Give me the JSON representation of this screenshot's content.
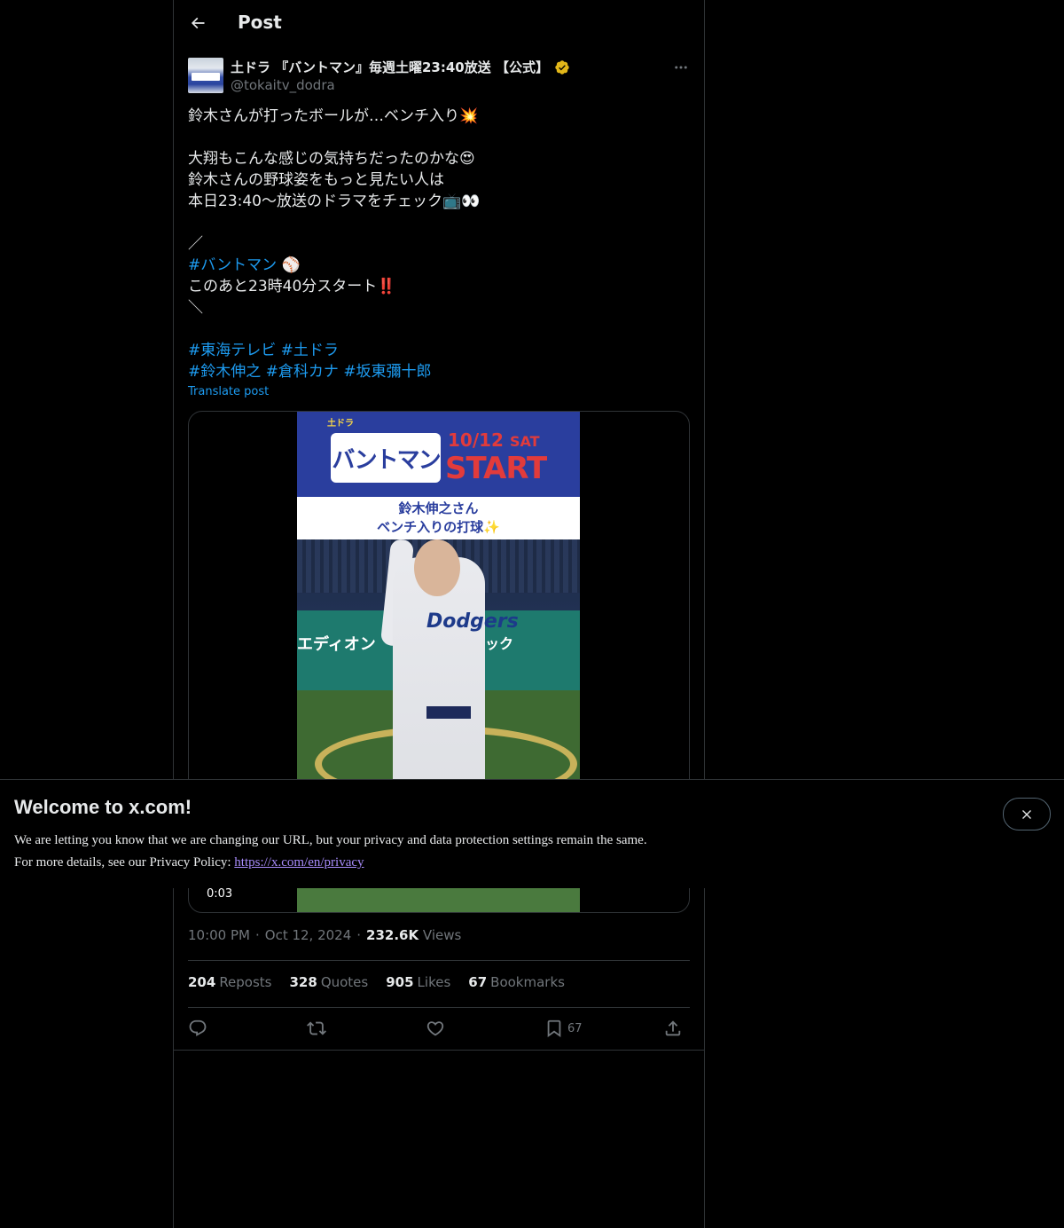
{
  "header": {
    "title": "Post"
  },
  "author": {
    "name": "土ドラ 『バントマン』毎週土曜23:40放送 【公式】",
    "handle": "@tokaitv_dodra"
  },
  "tweet": {
    "lines": [
      {
        "text": "鈴木さんが打ったボールが…ベンチ入り",
        "emoji": "💥"
      },
      {
        "text": "",
        "emoji": ""
      },
      {
        "text": "大翔もこんな感じの気持ちだったのかな",
        "emoji": "😍"
      },
      {
        "text": "鈴木さんの野球姿をもっと見たい人は",
        "emoji": ""
      },
      {
        "text": "本日23:40〜放送のドラマをチェック",
        "emoji": "📺👀"
      },
      {
        "text": "",
        "emoji": ""
      },
      {
        "text": "／",
        "emoji": ""
      },
      {
        "hashtag": "#バントマン",
        "emoji": " ⚾"
      },
      {
        "text": "このあと23時40分スタート",
        "emoji": "‼️"
      },
      {
        "text": "＼",
        "emoji": ""
      },
      {
        "text": "",
        "emoji": ""
      }
    ],
    "hashtag_line1": [
      "#東海テレビ",
      "#土ドラ"
    ],
    "hashtag_line2": [
      "#鈴木伸之",
      "#倉科カナ",
      "#坂東彌十郎"
    ],
    "translate_label": "Translate post"
  },
  "media": {
    "logo_small": "土ドラ",
    "logo_text": "バントマン",
    "date_text": "10/12",
    "date_day": "SAT",
    "start_text": "START",
    "caption_line1": "鈴木伸之さん",
    "caption_line2": "ベンチ入りの打球",
    "caption_emoji": "✨",
    "wall_text_left": "エディオン",
    "wall_text_right": "ネック",
    "jersey_text": "Dodgers",
    "duration": "0:03"
  },
  "meta": {
    "time": "10:00 PM",
    "date": "Oct 12, 2024",
    "views_count": "232.6K",
    "views_label": "Views"
  },
  "stats": {
    "reposts_count": "204",
    "reposts_label": "Reposts",
    "quotes_count": "328",
    "quotes_label": "Quotes",
    "likes_count": "905",
    "likes_label": "Likes",
    "bookmarks_count": "67",
    "bookmarks_label": "Bookmarks"
  },
  "actions": {
    "bookmark_count": "67"
  },
  "banner": {
    "title": "Welcome to x.com!",
    "line1": "We are letting you know that we are changing our URL, but your privacy and data protection settings remain the same.",
    "line2_prefix": "For more details, see our Privacy Policy: ",
    "link": "https://x.com/en/privacy"
  },
  "colors": {
    "background": "#000000",
    "text": "#e7e9ea",
    "secondary": "#71767b",
    "accent": "#1d9bf0",
    "verified_gold": "#e2b719"
  }
}
